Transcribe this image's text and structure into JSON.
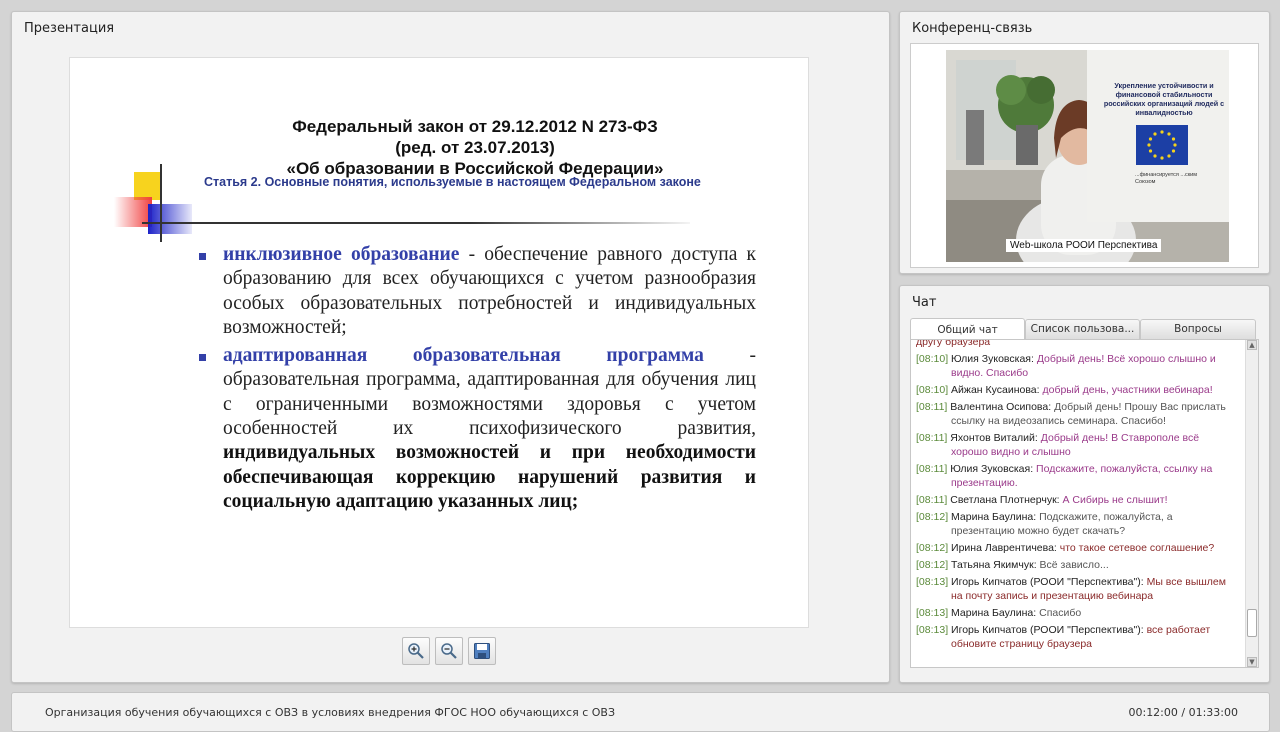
{
  "presentation": {
    "title": "Презентация",
    "slide": {
      "law_line1": "Федеральный закон от 29.12.2012 N 273-ФЗ",
      "law_line2": "(ред. от 23.07.2013)",
      "law_line3": "«Об образовании в Российской Федерации»",
      "article": "Статья 2. Основные понятия, используемые в настоящем Федеральном законе",
      "bullet1_term": "инклюзивное образование",
      "bullet1_text": " - обеспечение равного доступа к образованию для всех обучающихся с учетом разнообразия особых образовательных потребностей и индивидуальных возможностей;",
      "bullet2_term": "адаптированная образовательная программа",
      "bullet2_text": " - образовательная программа, адаптированная для обучения лиц с ограниченными возможностями здоровья с учетом особенностей их психофизического развития, ",
      "bullet2_bold": "индивидуальных возможностей и при необходимости обеспечивающая коррекцию нарушений развития и социальную адаптацию указанных лиц;"
    },
    "tools": {
      "zoom_in_icon": "zoom-in-icon",
      "zoom_out_icon": "zoom-out-icon",
      "save_icon": "save-icon"
    }
  },
  "conference": {
    "title": "Конференц-связь",
    "video_caption": "Web-школа РООИ Перспектива",
    "banner_text": "Укрепление устойчивости и финансовой стабильности российских организаций людей с инвалидностью",
    "banner_text2": "...финансируется ...ским Союзом"
  },
  "chat": {
    "title": "Чат",
    "tabs": [
      "Общий чат",
      "Список пользова...",
      "Вопросы"
    ],
    "messages": [
      {
        "time": "",
        "author": "",
        "text": "другу браузера",
        "tone": "dark"
      },
      {
        "time": "[08:10]",
        "author": "Юлия Зуковская:",
        "text": "Добрый день! Всё хорошо слышно и видно. Спасибо",
        "tone": "purple"
      },
      {
        "time": "[08:10]",
        "author": "Айжан Кусаинова:",
        "text": "добрый день, участники вебинара!",
        "tone": "purple"
      },
      {
        "time": "[08:11]",
        "author": "Валентина Осипова:",
        "text": "Добрый день! Прошу Вас прислать ссылку на видеозапись семинара. Спасибо!",
        "tone": "gray"
      },
      {
        "time": "[08:11]",
        "author": "Яхонтов Виталий:",
        "text": "Добрый день! В Ставрополе всё хорошо видно и слышно",
        "tone": "purple"
      },
      {
        "time": "[08:11]",
        "author": "Юлия Зуковская:",
        "text": "Подскажите, пожалуйста, ссылку на презентацию.",
        "tone": "purple"
      },
      {
        "time": "[08:11]",
        "author": "Светлана Плотнерчук:",
        "text": "А Сибирь не слышит!",
        "tone": "purple"
      },
      {
        "time": "[08:12]",
        "author": "Марина Баулина:",
        "text": "Подскажите, пожалуйста, а презентацию можно будет скачать?",
        "tone": "gray"
      },
      {
        "time": "[08:12]",
        "author": "Ирина Лаврентичева:",
        "text": "что такое сетевое соглашение?",
        "tone": "dark"
      },
      {
        "time": "[08:12]",
        "author": "Татьяна Якимчук:",
        "text": "Всё зависло...",
        "tone": "gray"
      },
      {
        "time": "[08:13]",
        "author": "Игорь Кипчатов (РООИ \"Перспектива\"):",
        "text": "Мы все вышлем на почту запись и презентацию вебинара",
        "tone": "dark"
      },
      {
        "time": "[08:13]",
        "author": "Марина Баулина:",
        "text": "Спасибо",
        "tone": "gray"
      },
      {
        "time": "[08:13]",
        "author": "Игорь Кипчатов (РООИ \"Перспектива\"):",
        "text": "все работает обновите страницу браузера",
        "tone": "dark"
      }
    ]
  },
  "footer": {
    "title": "Организация обучения обучающихся с ОВЗ в условиях внедрения ФГОС НОО обучающихся с ОВЗ",
    "time": "00:12:00 / 01:33:00"
  }
}
